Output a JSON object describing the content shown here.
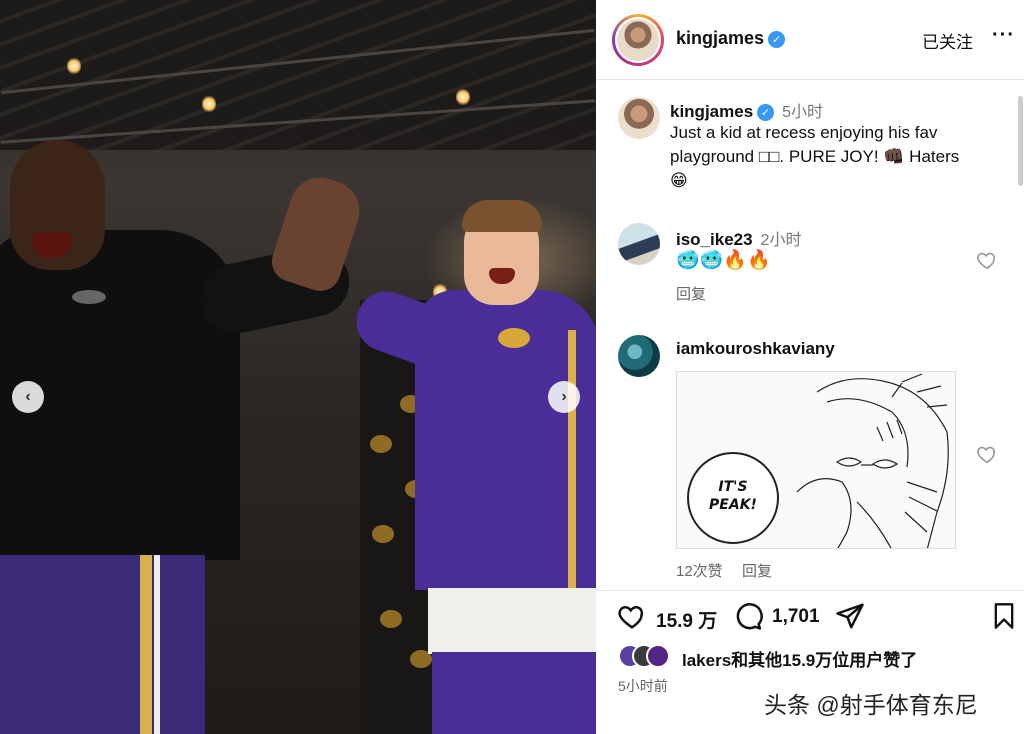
{
  "post": {
    "username": "kingjames",
    "follow_label": "已关注",
    "more_label": "···",
    "caption_time": "5小时",
    "caption_line1": "Just a kid at recess enjoying his fav",
    "caption_line2": "playground □□. PURE JOY! 👊🏿 Haters",
    "caption_line3": "😁"
  },
  "comments": [
    {
      "username": "iso_ike23",
      "time": "2小时",
      "text": "🥶🥶🔥🔥",
      "reply_label": "回复"
    },
    {
      "username": "iamkouroshkaviany",
      "image_text_line1": "IT'S",
      "image_text_line2": "PEAK!",
      "likes_label": "12次赞",
      "reply_label": "回复"
    }
  ],
  "actions": {
    "like_count": "15.9 万",
    "comment_count": "1,701"
  },
  "liked_by": "lakers和其他15.9万位用户赞了",
  "post_time": "5小时前",
  "watermark": "头条 @射手体育东尼",
  "carousel": {
    "prev_symbol": "‹",
    "next_symbol": "›"
  },
  "colors": {
    "verified": "#3897f0",
    "lakers_purple": "#4a2d96",
    "lakers_gold": "#d9b24e"
  }
}
